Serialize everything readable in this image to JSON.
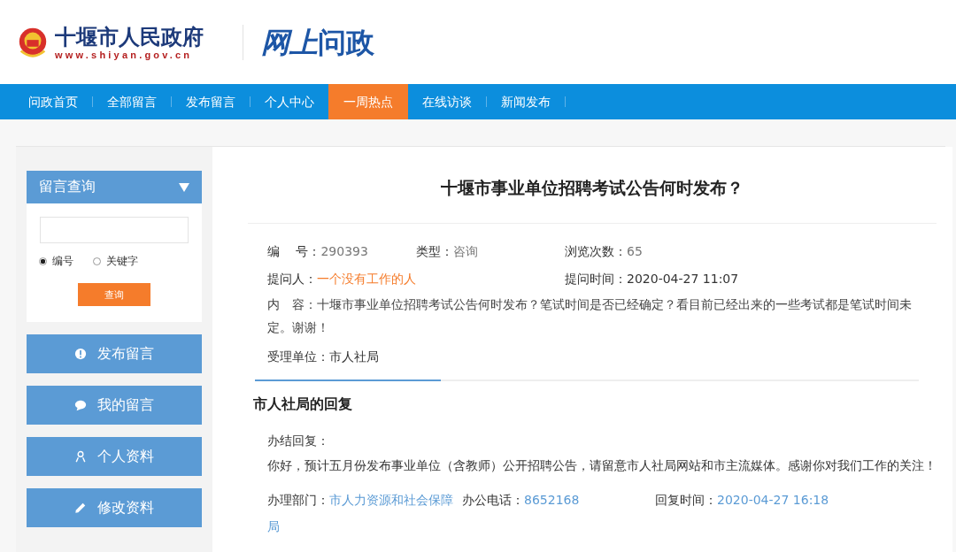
{
  "header": {
    "site_name": "十堰市人民政府",
    "site_url": "www.shiyan.gov.cn",
    "portal_name_a": "网上",
    "portal_name_b": "问政"
  },
  "nav": [
    {
      "label": "问政首页",
      "selected": false
    },
    {
      "label": "全部留言",
      "selected": false
    },
    {
      "label": "发布留言",
      "selected": false
    },
    {
      "label": "个人中心",
      "selected": false
    },
    {
      "label": "一周热点",
      "selected": true
    },
    {
      "label": "在线访谈",
      "selected": false
    },
    {
      "label": "新闻发布",
      "selected": false
    }
  ],
  "sidebar": {
    "query": {
      "title": "留言查询",
      "options": [
        {
          "label": "编号",
          "selected": true
        },
        {
          "label": "关键字",
          "selected": false
        }
      ],
      "button": "查询"
    },
    "menu": [
      {
        "kind": "alert",
        "label": "发布留言"
      },
      {
        "kind": "chat",
        "label": "我的留言"
      },
      {
        "kind": "person",
        "label": "个人资料"
      },
      {
        "kind": "edit",
        "label": "修改资料"
      }
    ]
  },
  "question": {
    "title": "十堰市事业单位招聘考试公告何时发布？",
    "number": {
      "label": "编　 号：",
      "value": "290393"
    },
    "type": {
      "label": "类型：",
      "value": "咨询"
    },
    "views": {
      "label": "浏览次数：",
      "value": "65"
    },
    "asker": {
      "label": "提问人：",
      "value": "一个没有工作的人"
    },
    "asked_at": {
      "label": "提问时间：",
      "value": "2020-04-27 11:07"
    },
    "content_label": "内　容：",
    "content": "十堰市事业单位招聘考试公告何时发布？笔试时间是否已经确定？看目前已经出来的一些考试都是笔试时间未定。谢谢！",
    "unit_label": "受理单位：",
    "unit": "市人社局"
  },
  "reply": {
    "tab": "市人社局的回复",
    "label": "办结回复：",
    "text": "你好，预计五月份发布事业单位（含教师）公开招聘公告，请留意市人社局网站和市主流媒体。感谢你对我们工作的关注！",
    "meta": [
      {
        "label": "办理部门：",
        "value": "市人力资源和社会保障局"
      },
      {
        "label": "办公电话：",
        "value": "8652168"
      },
      {
        "label": "回复时间：",
        "value": "2020-04-27 16:18"
      }
    ]
  }
}
